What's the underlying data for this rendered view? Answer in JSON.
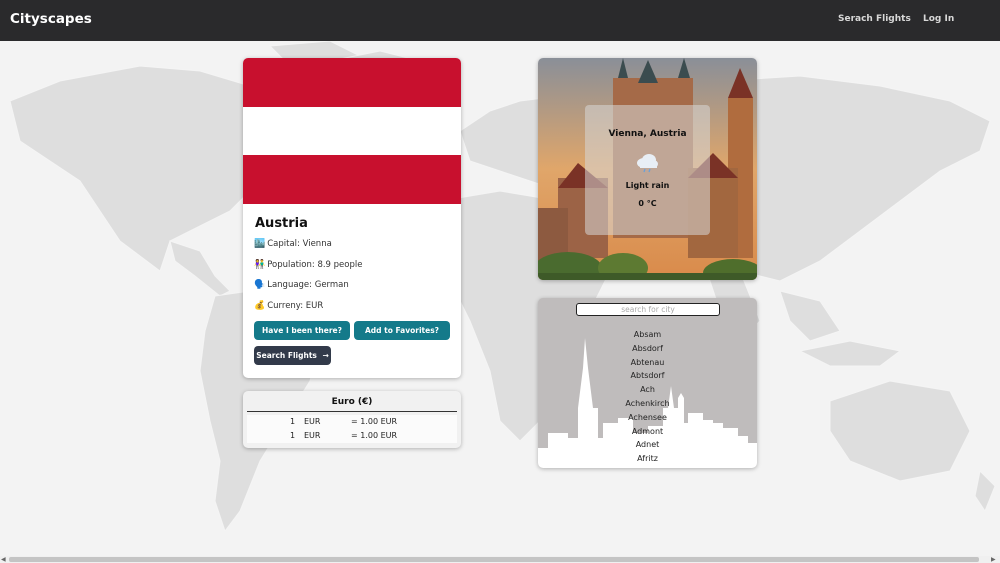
{
  "navbar": {
    "brand": "Cityscapes",
    "links": [
      "Serach Flights",
      "Log In"
    ]
  },
  "country": {
    "name": "Austria",
    "flag_colors": [
      "#c8102e",
      "#ffffff",
      "#c8102e"
    ],
    "info": [
      {
        "icon": "🏙️",
        "icon_name": "city-icon",
        "label": "Capital: Vienna"
      },
      {
        "icon": "👫",
        "icon_name": "people-icon",
        "label": "Population: 8.9 people"
      },
      {
        "icon": "🗣️",
        "icon_name": "speaking-head-icon",
        "label": "Language: German"
      },
      {
        "icon": "💰",
        "icon_name": "money-bag-icon",
        "label": "Curreny: EUR"
      }
    ],
    "buttons": {
      "been_there": "Have I been there?",
      "favorites": "Add to Favorites?",
      "search_flights": "Search Flights",
      "search_flights_icon": "→"
    }
  },
  "currency": {
    "title": "Euro (€)",
    "rows": [
      {
        "amount": "1",
        "code": "EUR",
        "result": "= 1.00 EUR"
      },
      {
        "amount": "1",
        "code": "EUR",
        "result": "= 1.00 EUR"
      }
    ]
  },
  "weather": {
    "city": "Vienna, Austria",
    "icon": "cloud-rain-icon",
    "description": "Light rain",
    "temperature": "0 °C"
  },
  "city_search": {
    "placeholder": "search for city",
    "value": "",
    "cities": [
      "Absam",
      "Absdorf",
      "Abtenau",
      "Abtsdorf",
      "Ach",
      "Achenkirch",
      "Achensee",
      "Admont",
      "Adnet",
      "Afritz"
    ]
  },
  "colors": {
    "navbar": "#2a2a2c",
    "teal_button": "#147a8a",
    "dark_button": "#323a4a",
    "map_land": "#dcdcdc",
    "background": "#f3f3f3"
  }
}
